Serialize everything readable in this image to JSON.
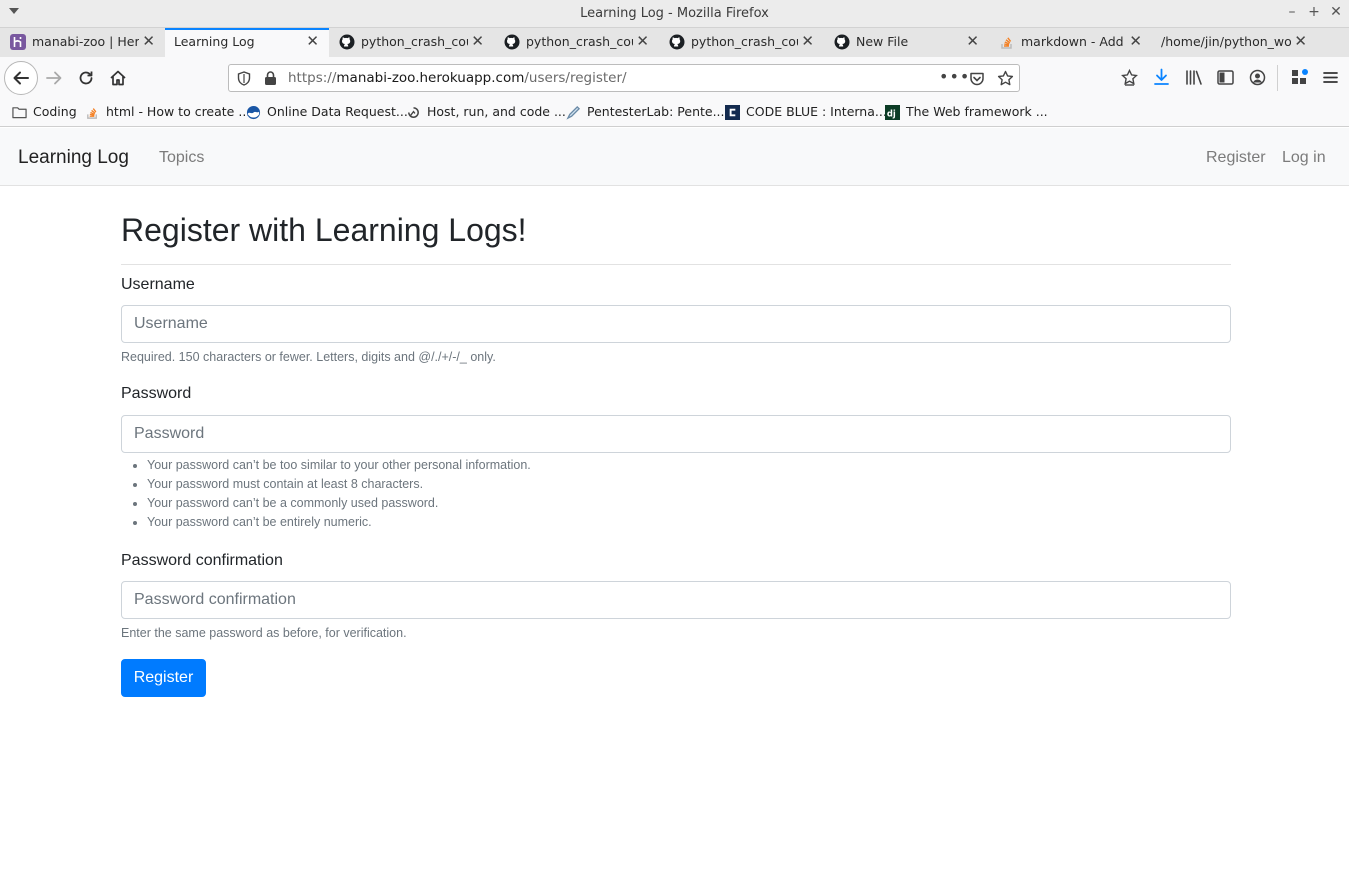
{
  "window": {
    "title": "Learning Log - Mozilla Firefox"
  },
  "tabs": [
    {
      "label": "manabi-zoo | Hero",
      "icon": "heroku-icon",
      "active": false
    },
    {
      "label": "Learning Log",
      "icon": "",
      "active": true
    },
    {
      "label": "python_crash_cou",
      "icon": "github-icon",
      "active": false
    },
    {
      "label": "python_crash_cou",
      "icon": "github-icon",
      "active": false
    },
    {
      "label": "python_crash_cou",
      "icon": "github-icon",
      "active": false
    },
    {
      "label": "New File",
      "icon": "github-icon",
      "active": false
    },
    {
      "label": "markdown - Add in",
      "icon": "stackoverflow-icon",
      "active": false
    },
    {
      "label": "/home/jin/python_wor",
      "icon": "",
      "active": false
    }
  ],
  "urlbar": {
    "url_prefix": "https://",
    "url_host": "manabi-zoo.herokuapp.com",
    "url_path": "/users/register/"
  },
  "bookmarks": [
    {
      "label": "Coding",
      "icon": "folder-icon"
    },
    {
      "label": "html - How to create ...",
      "icon": "stackoverflow-icon"
    },
    {
      "label": "Online Data Request...",
      "icon": "noaa-icon"
    },
    {
      "label": "Host, run, and code ...",
      "icon": "replit-icon"
    },
    {
      "label": "PentesterLab: Pente...",
      "icon": "pentesterlab-icon"
    },
    {
      "label": "CODE BLUE : Interna...",
      "icon": "codeblue-icon"
    },
    {
      "label": "The Web framework ...",
      "icon": "django-icon"
    }
  ],
  "site_nav": {
    "brand": "Learning Log",
    "topics": "Topics",
    "register": "Register",
    "login": "Log in"
  },
  "form": {
    "heading": "Register with Learning Logs!",
    "username_label": "Username",
    "username_placeholder": "Username",
    "username_help": "Required. 150 characters or fewer. Letters, digits and @/./+/-/_ only.",
    "password_label": "Password",
    "password_placeholder": "Password",
    "password_rules": [
      "Your password can’t be too similar to your other personal information.",
      "Your password must contain at least 8 characters.",
      "Your password can’t be a commonly used password.",
      "Your password can’t be entirely numeric."
    ],
    "confirm_label": "Password confirmation",
    "confirm_placeholder": "Password confirmation",
    "confirm_help": "Enter the same password as before, for verification.",
    "submit_label": "Register"
  },
  "colors": {
    "accent": "#0a84ff",
    "button": "#007bff"
  }
}
